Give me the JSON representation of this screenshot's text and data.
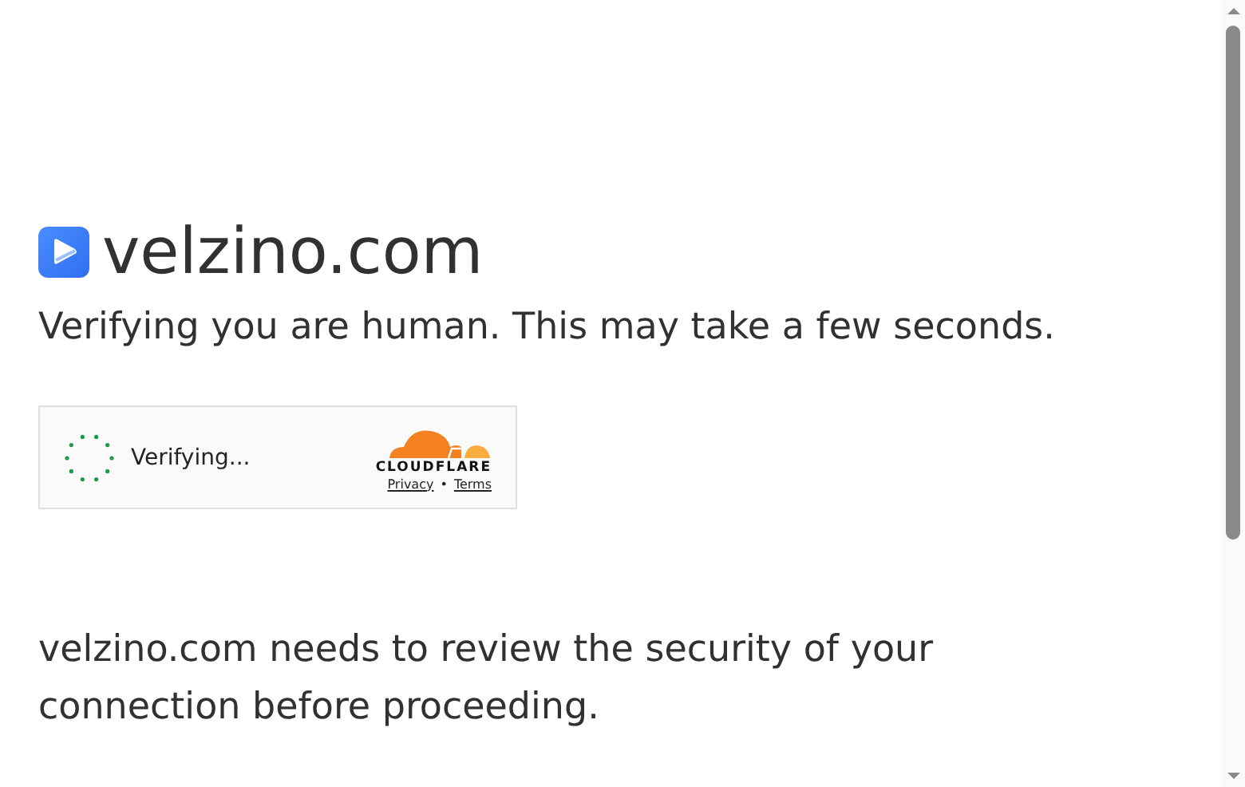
{
  "site": {
    "name": "velzino.com"
  },
  "subtitle": "Verifying you are human. This may take a few seconds.",
  "widget": {
    "status": "Verifying...",
    "brand": "CLOUDFLARE",
    "links": [
      "Privacy",
      "Terms"
    ],
    "separator": "•"
  },
  "message": "velzino.com needs to review the security of your connection before proceeding."
}
